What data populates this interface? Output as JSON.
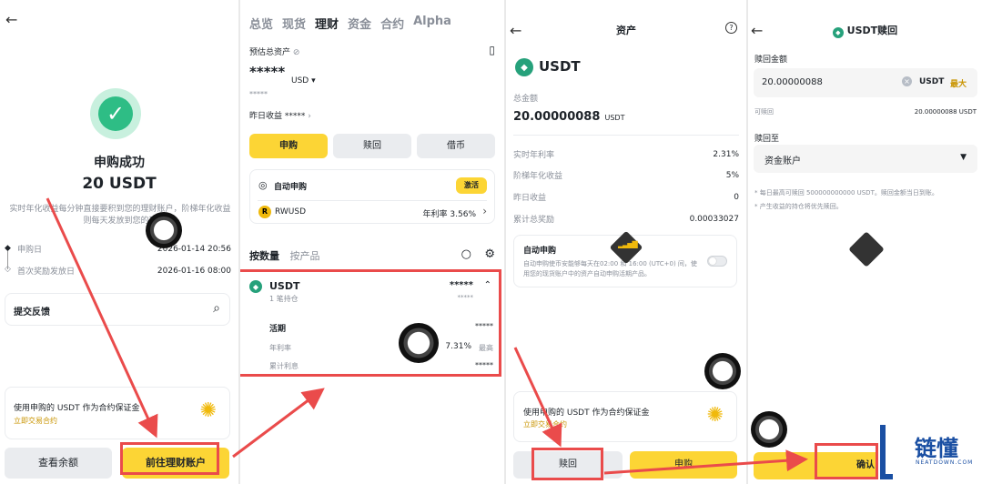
{
  "screen1": {
    "title": "申购成功",
    "amount": "20 USDT",
    "desc": "实时年化收益每分钟直接要积到您的理财账户，阶梯年化收益则每天发放到您的现",
    "subscribe_label": "申购日",
    "subscribe_value": "2026-01-14 20:56",
    "first_reward_label": "首次奖励发放日",
    "first_reward_value": "2026-01-16 08:00",
    "feedback": "提交反馈",
    "promo_text": "使用申购的 USDT 作为合约保证金",
    "promo_link": "立即交易合约",
    "btn_balance": "查看余额",
    "btn_go": "前往理财账户"
  },
  "screen2": {
    "tabs": [
      "总览",
      "现货",
      "理财",
      "资金",
      "合约",
      "Alpha"
    ],
    "est_label": "预估总资产",
    "est_value": "*****",
    "currency": "USD",
    "est_sub": "*****",
    "yesterday_label": "昨日收益",
    "yesterday_value": "*****",
    "btn_subscribe": "申购",
    "btn_redeem": "赎回",
    "btn_borrow": "借币",
    "auto_label": "自动申购",
    "auto_btn": "激活",
    "rwusd": "RWUSD",
    "rwusd_rate": "年利率 3.56%",
    "sort_qty": "按数量",
    "sort_product": "按产品",
    "usdt": "USDT",
    "usdt_hold": "1 笔持仓",
    "usdt_value": "*****",
    "usdt_value2": "*****",
    "flex_label": "活期",
    "flex_value": "*****",
    "apr_label": "年利率",
    "apr_value": "7.31%",
    "apr_tag": "最高",
    "interest_label": "累计利息",
    "interest_value": "*****"
  },
  "screen3": {
    "header": "资产",
    "coin": "USDT",
    "total_label": "总金额",
    "total_value": "20.00000088",
    "total_unit": "USDT",
    "rows": [
      {
        "label": "实时年利率",
        "value": "2.31%"
      },
      {
        "label": "阶梯年化收益",
        "value": "5%"
      },
      {
        "label": "昨日收益",
        "value": "0"
      },
      {
        "label": "累计总奖励",
        "value": "0.00033027"
      }
    ],
    "auto_title": "自动申购",
    "auto_desc": "自动申购使币安能够每天在02:00 和 16:00 (UTC+0) 间，使用您的现货账户中的资产自动申购活期产品。",
    "promo_text": "使用申购的 USDT 作为合约保证金",
    "promo_link": "立即交易合约",
    "btn_redeem": "赎回",
    "btn_subscribe": "申购"
  },
  "screen4": {
    "header": "USDT赎回",
    "amount_label": "赎回金额",
    "amount_value": "20.00000088",
    "unit": "USDT",
    "max": "最大",
    "avail_label": "可赎回",
    "avail_value": "20.00000088 USDT",
    "to_label": "赎回至",
    "to_value": "资金账户",
    "note1": "* 每日最高可赎回 500000000000 USDT。赎回金额当日到账。",
    "note2": "* 产生收益的持仓将优先赎回。",
    "btn_confirm": "确认"
  },
  "watermark": {
    "brand": "链懂",
    "site": "NEATDOWN.COM"
  },
  "colors": {
    "accent": "#fcd535",
    "success": "#2ebd85",
    "annotation": "#ea4b4b",
    "usdt": "#26a17b"
  }
}
